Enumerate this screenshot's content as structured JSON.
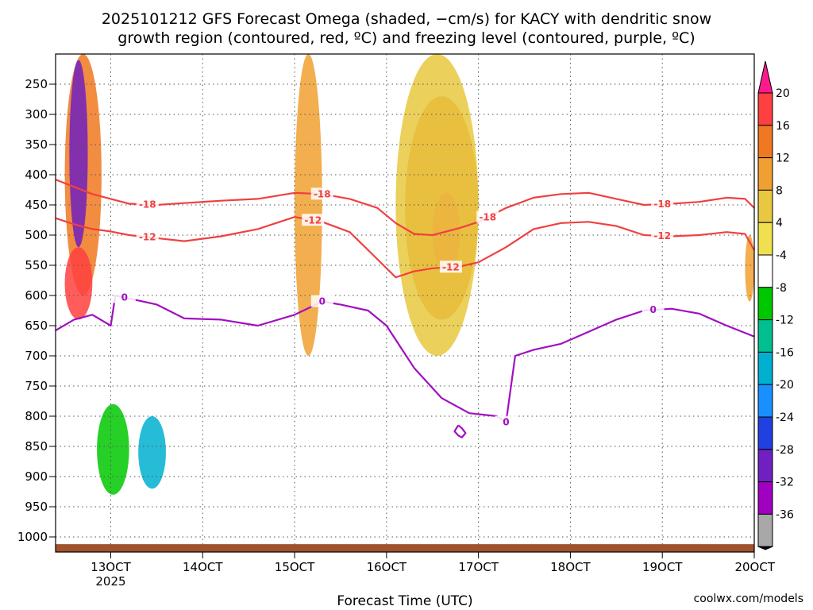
{
  "colors": {
    "temperature_contour": "#f04040",
    "freezing_contour": "#a010c0",
    "terrain": "#a0522d",
    "grid": "#555555",
    "watermark": "#d02020"
  },
  "chart_data": {
    "type": "heatmap",
    "title": [
      "2025101212 GFS Forecast Omega (shaded, −cm/s) for KACY with dendritic snow",
      "growth region (contoured, red, ºC) and freezing level (contoured, purple, ºC)"
    ],
    "xlabel": "Forecast Time (UTC)",
    "xlim": [
      12.4,
      20.0
    ],
    "x_ticks": [
      {
        "value": 13,
        "label": "13OCT",
        "sublabel": "2025"
      },
      {
        "value": 14,
        "label": "14OCT"
      },
      {
        "value": 15,
        "label": "15OCT"
      },
      {
        "value": 16,
        "label": "16OCT"
      },
      {
        "value": 17,
        "label": "17OCT"
      },
      {
        "value": 18,
        "label": "18OCT"
      },
      {
        "value": 19,
        "label": "19OCT"
      },
      {
        "value": 20,
        "label": "20OCT"
      }
    ],
    "ylabel": "",
    "ylim": [
      1025,
      200
    ],
    "y_ticks": [
      250,
      300,
      350,
      400,
      450,
      500,
      550,
      600,
      650,
      700,
      750,
      800,
      850,
      900,
      950,
      1000
    ],
    "grid": "dotted",
    "colorbar": {
      "levels": [
        20,
        16,
        12,
        8,
        4,
        -4,
        -8,
        -12,
        -16,
        -20,
        -24,
        -28,
        -32,
        -36
      ],
      "colors": [
        "#ff1a8c",
        "#ff4040",
        "#f07820",
        "#f0a030",
        "#e8c840",
        "#f0e050",
        "#ffffff",
        "#00c800",
        "#00c090",
        "#00b0d0",
        "#1890ff",
        "#2040e0",
        "#7020c0",
        "#a000c0",
        "#a8a8a8",
        "#000000"
      ]
    },
    "contours": [
      {
        "kind": "temperature",
        "level": -18,
        "label": "-18",
        "x": [
          12.4,
          12.6,
          12.8,
          13.0,
          13.2,
          13.5,
          13.8,
          14.2,
          14.6,
          15.0,
          15.3,
          15.6,
          15.9,
          16.1,
          16.3,
          16.5,
          16.8,
          17.0,
          17.3,
          17.6,
          17.9,
          18.2,
          18.5,
          18.8,
          19.1,
          19.4,
          19.7,
          19.9,
          20.0
        ],
        "p": [
          408,
          420,
          432,
          440,
          448,
          450,
          447,
          443,
          440,
          430,
          432,
          440,
          455,
          480,
          498,
          500,
          488,
          478,
          455,
          438,
          432,
          430,
          440,
          450,
          448,
          445,
          438,
          440,
          455
        ],
        "labels_at": [
          13.4,
          15.3,
          17.1,
          19.0
        ]
      },
      {
        "kind": "temperature",
        "level": -12,
        "label": "-12",
        "x": [
          12.4,
          12.6,
          12.8,
          13.0,
          13.2,
          13.5,
          13.8,
          14.2,
          14.6,
          15.0,
          15.3,
          15.6,
          15.9,
          16.1,
          16.3,
          16.5,
          16.8,
          17.0,
          17.3,
          17.6,
          17.9,
          18.2,
          18.5,
          18.8,
          19.1,
          19.4,
          19.7,
          19.9,
          20.0
        ],
        "p": [
          472,
          482,
          490,
          494,
          500,
          505,
          510,
          502,
          490,
          470,
          478,
          495,
          540,
          570,
          560,
          555,
          552,
          545,
          520,
          490,
          480,
          478,
          485,
          500,
          502,
          500,
          495,
          498,
          525
        ],
        "labels_at": [
          13.4,
          15.2,
          16.7,
          19.0
        ]
      },
      {
        "kind": "freezing",
        "level": 0,
        "label": "0",
        "x": [
          12.4,
          12.6,
          12.8,
          13.0,
          13.05,
          13.2,
          13.5,
          13.8,
          14.2,
          14.6,
          15.0,
          15.3,
          15.5,
          15.8,
          16.0,
          16.3,
          16.6,
          16.9,
          17.2,
          17.3,
          17.4,
          17.6,
          17.9,
          18.2,
          18.5,
          18.8,
          19.1,
          19.4,
          19.7,
          19.9,
          20.0
        ],
        "p": [
          658,
          640,
          632,
          650,
          600,
          605,
          615,
          638,
          640,
          650,
          632,
          610,
          615,
          625,
          650,
          720,
          770,
          795,
          800,
          810,
          700,
          690,
          680,
          660,
          640,
          625,
          622,
          630,
          650,
          662,
          668
        ],
        "labels_at": [
          13.15,
          15.3,
          17.3,
          18.9
        ]
      },
      {
        "kind": "freezing",
        "level": 0,
        "label": "",
        "x": [
          16.78,
          16.82,
          16.86,
          16.82,
          16.78,
          16.74,
          16.78
        ],
        "p": [
          815,
          820,
          828,
          835,
          832,
          825,
          815
        ],
        "labels_at": []
      }
    ],
    "shaded_regions": [
      {
        "value": 12,
        "x": [
          12.5,
          12.9
        ],
        "p": [
          200,
          600
        ]
      },
      {
        "value": -32,
        "x": [
          12.55,
          12.75
        ],
        "p": [
          210,
          520
        ]
      },
      {
        "value": 16,
        "x": [
          12.5,
          12.8
        ],
        "p": [
          520,
          640
        ]
      },
      {
        "value": -12,
        "x": [
          12.85,
          13.2
        ],
        "p": [
          780,
          930
        ]
      },
      {
        "value": -20,
        "x": [
          13.3,
          13.6
        ],
        "p": [
          800,
          920
        ]
      },
      {
        "value": -8,
        "x": [
          13.8,
          14.2
        ],
        "p": [
          870,
          950
        ]
      },
      {
        "value": 8,
        "x": [
          15.0,
          15.3
        ],
        "p": [
          200,
          700
        ]
      },
      {
        "value": -8,
        "x": [
          15.7,
          16.0
        ],
        "p": [
          200,
          420
        ]
      },
      {
        "value": 12,
        "x": [
          16.2,
          17.0
        ],
        "p": [
          270,
          640
        ]
      },
      {
        "value": 16,
        "x": [
          16.5,
          16.8
        ],
        "p": [
          430,
          560
        ]
      },
      {
        "value": 4,
        "x": [
          16.1,
          17.0
        ],
        "p": [
          200,
          700
        ]
      },
      {
        "value": -8,
        "x": [
          19.3,
          19.5
        ],
        "p": [
          240,
          290
        ]
      },
      {
        "value": -8,
        "x": [
          19.9,
          20.0
        ],
        "p": [
          610,
          740
        ]
      },
      {
        "value": 8,
        "x": [
          19.9,
          20.0
        ],
        "p": [
          500,
          610
        ]
      }
    ],
    "terrain_top_p": 1012,
    "watermark": "coolwx.com/models"
  }
}
